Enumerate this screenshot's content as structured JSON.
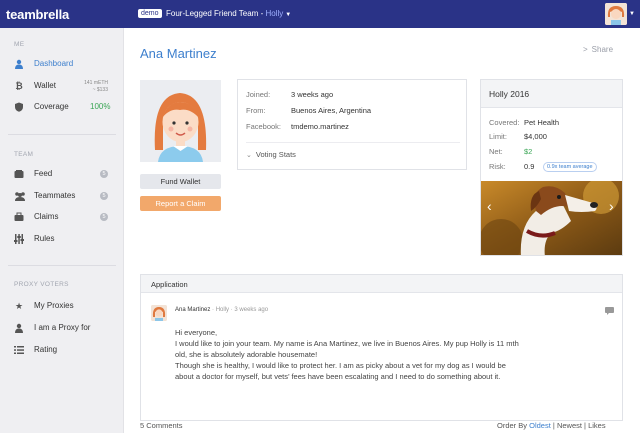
{
  "topbar": {
    "logo": "teambrella",
    "demo_badge": "demo",
    "team_name": "Four-Legged Friend Team",
    "separator": " - ",
    "user": "Holly"
  },
  "sidebar": {
    "sections": {
      "me": "ME",
      "team": "TEAM",
      "proxy": "PROXY VOTERS"
    },
    "items": {
      "dashboard": "Dashboard",
      "wallet": "Wallet",
      "wallet_mbtc": "141 mETH",
      "wallet_usd": "~ $133",
      "coverage": "Coverage",
      "coverage_val": "100%",
      "feed": "Feed",
      "feed_count": "5",
      "teammates": "Teammates",
      "teammates_count": "5",
      "claims": "Claims",
      "claims_count": "5",
      "rules": "Rules",
      "my_proxies": "My Proxies",
      "i_am_proxy": "I am a Proxy for",
      "rating": "Rating"
    }
  },
  "profile": {
    "name": "Ana Martinez",
    "share": "Share",
    "fund_wallet": "Fund Wallet",
    "report_claim": "Report a Claim",
    "joined_label": "Joined:",
    "joined_val": "3 weeks ago",
    "from_label": "From:",
    "from_val": "Buenos Aires, Argentina",
    "facebook_label": "Facebook:",
    "facebook_val": "tmdemo.martinez",
    "voting_stats": "Voting Stats"
  },
  "team_card": {
    "title": "Holly 2016",
    "covered_label": "Covered:",
    "covered_val": "Pet Health",
    "limit_label": "Limit:",
    "limit_val": "$4,000",
    "net_label": "Net:",
    "net_val": "$2",
    "risk_label": "Risk:",
    "risk_val": "0.9",
    "risk_badge": "0.9x team average"
  },
  "application": {
    "title": "Application",
    "author": "Ana Martinez",
    "meta_pet": "Holly",
    "meta_time": "3 weeks ago",
    "body": [
      "Hi everyone,",
      "I would like to join your team. My name is Ana Martinez, we live in Buenos Aires. My pup Holly is 11 mth",
      "old, she is absolutely adorable housemate!",
      "Though she is healthy, I would like to protect her. I am as picky about a vet for my dog as I would be",
      "about a doctor for myself, but vets’ fees have been escalating and I need to do something about it."
    ]
  },
  "comments": {
    "count": "5 Comments",
    "order_by": "Order By",
    "oldest": "Oldest",
    "newest": "Newest",
    "likes": "Likes"
  },
  "colors": {
    "topbar": "#2a3387",
    "accent": "#3d7fcd",
    "claim_button": "#f2a86b",
    "positive": "#3aa655"
  }
}
